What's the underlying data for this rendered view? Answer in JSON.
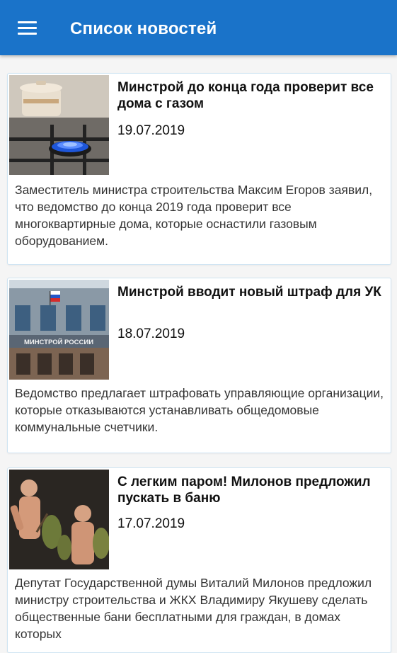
{
  "app": {
    "title": "Список новостей"
  },
  "news": [
    {
      "title": "Минстрой до конца года проверит все дома с газом",
      "date": "19.07.2019",
      "description": "Заместитель министра строительства Максим Егоров заявил, что ведомство до конца 2019 года проверит все многоквартирные дома, которые оснастили газовым оборудованием."
    },
    {
      "title": "Минстрой вводит новый штраф для УК",
      "date": "18.07.2019",
      "description": "Ведомство предлагает штрафовать управляющие организации,  которые отказываются устанавливать общедомовые коммунальные счетчики.",
      "image_text": "МИНСТРОЙ РОССИИ"
    },
    {
      "title": "С легким паром! Милонов предложил пускать в баню",
      "date": "17.07.2019",
      "description": "Депутат Государственной думы Виталий Милонов предложил министру строительства и ЖКХ Владимиру Якушеву сделать общественные бани бесплатными для граждан, в домах которых"
    }
  ]
}
